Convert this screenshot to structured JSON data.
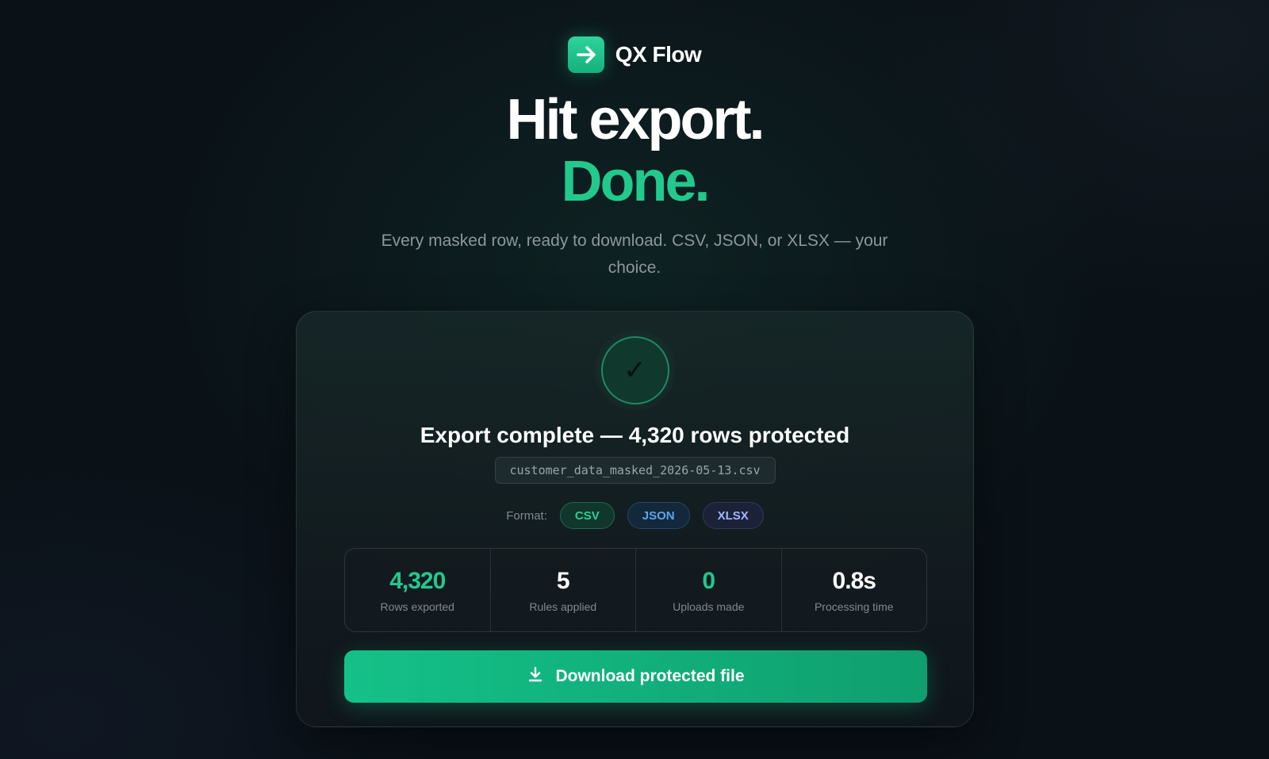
{
  "brand": {
    "name": "QX Flow",
    "logo_icon": "arrow-right-icon",
    "accent": "#22c98c"
  },
  "hero": {
    "line1": "Hit export.",
    "line2": "Done.",
    "subtitle": "Every masked row, ready to download. CSV, JSON, or XLSX — your choice."
  },
  "card": {
    "status_icon": "checkmark-icon",
    "status_glyph": "✓",
    "title": "Export complete — 4,320 rows protected",
    "filename": "customer_data_masked_2026-05-13.csv",
    "format_label": "Format:",
    "formats": [
      {
        "label": "CSV",
        "color": "#2ad096"
      },
      {
        "label": "JSON",
        "color": "#5aa6ef"
      },
      {
        "label": "XLSX",
        "color": "#a3b5ff"
      }
    ],
    "stats": [
      {
        "value": "4,320",
        "label": "Rows exported"
      },
      {
        "value": "5",
        "label": "Rules applied"
      },
      {
        "value": "0",
        "label": "Uploads made"
      },
      {
        "value": "0.8s",
        "label": "Processing time"
      }
    ],
    "download": {
      "label": "Download protected file",
      "icon": "download-icon"
    }
  }
}
